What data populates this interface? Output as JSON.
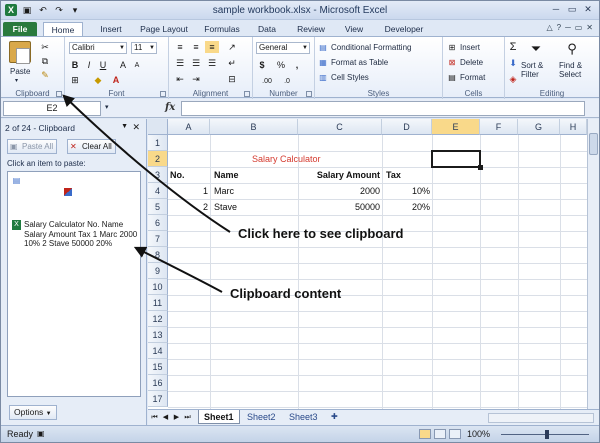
{
  "window": {
    "title": "sample workbook.xlsx - Microsoft Excel",
    "logo_text": "X"
  },
  "tabs": [
    {
      "label": "File"
    },
    {
      "label": "Home"
    },
    {
      "label": "Insert"
    },
    {
      "label": "Page Layout"
    },
    {
      "label": "Formulas"
    },
    {
      "label": "Data"
    },
    {
      "label": "Review"
    },
    {
      "label": "View"
    },
    {
      "label": "Developer"
    }
  ],
  "ribbon": {
    "clipboard": {
      "paste": "Paste",
      "label": "Clipboard"
    },
    "font": {
      "name": "Calibri",
      "size": "11",
      "label": "Font"
    },
    "alignment": {
      "label": "Alignment"
    },
    "number": {
      "format": "General",
      "label": "Number"
    },
    "styles": {
      "conditional": "Conditional Formatting",
      "format_table": "Format as Table",
      "cell_styles": "Cell Styles",
      "label": "Styles"
    },
    "cells": {
      "insert": "Insert",
      "delete": "Delete",
      "format": "Format",
      "label": "Cells"
    },
    "editing": {
      "sort_1": "Sort &",
      "sort_2": "Filter",
      "find_1": "Find &",
      "find_2": "Select",
      "label": "Editing"
    }
  },
  "formula_bar": {
    "name_box": "E2",
    "fx": "fx",
    "value": ""
  },
  "clipboard_pane": {
    "title": "2 of 24 - Clipboard",
    "paste_all": "Paste All",
    "clear_all": "Clear All",
    "hint": "Click an item to paste:",
    "item_text": "Salary Calculator No. Name Salary Amount Tax 1 Marc 2000  10% 2 Stave 50000 20%",
    "options": "Options"
  },
  "grid": {
    "columns": [
      "A",
      "B",
      "C",
      "D",
      "E",
      "F",
      "G",
      "H"
    ],
    "rows": [
      "1",
      "2",
      "3",
      "4",
      "5",
      "6",
      "7",
      "8",
      "9",
      "10",
      "11",
      "12",
      "13",
      "14",
      "15",
      "16",
      "17"
    ],
    "title": "Salary Calculator",
    "headers": {
      "no": "No.",
      "name": "Name",
      "amount": "Salary Amount",
      "tax": "Tax"
    },
    "data": [
      {
        "no": "1",
        "name": "Marc",
        "amount": "2000",
        "tax": "10%"
      },
      {
        "no": "2",
        "name": "Stave",
        "amount": "50000",
        "tax": "20%"
      }
    ]
  },
  "sheets": [
    {
      "label": "Sheet1"
    },
    {
      "label": "Sheet2"
    },
    {
      "label": "Sheet3"
    }
  ],
  "status": {
    "ready": "Ready",
    "zoom": "100%"
  },
  "annotations": {
    "clipboard_launcher": "Click here to see clipboard",
    "clipboard_content": "Clipboard content"
  },
  "colors": {
    "file_tab": "#2a7a3d",
    "title_red": "#d43a2f",
    "selection_header": "#f9d98a"
  }
}
